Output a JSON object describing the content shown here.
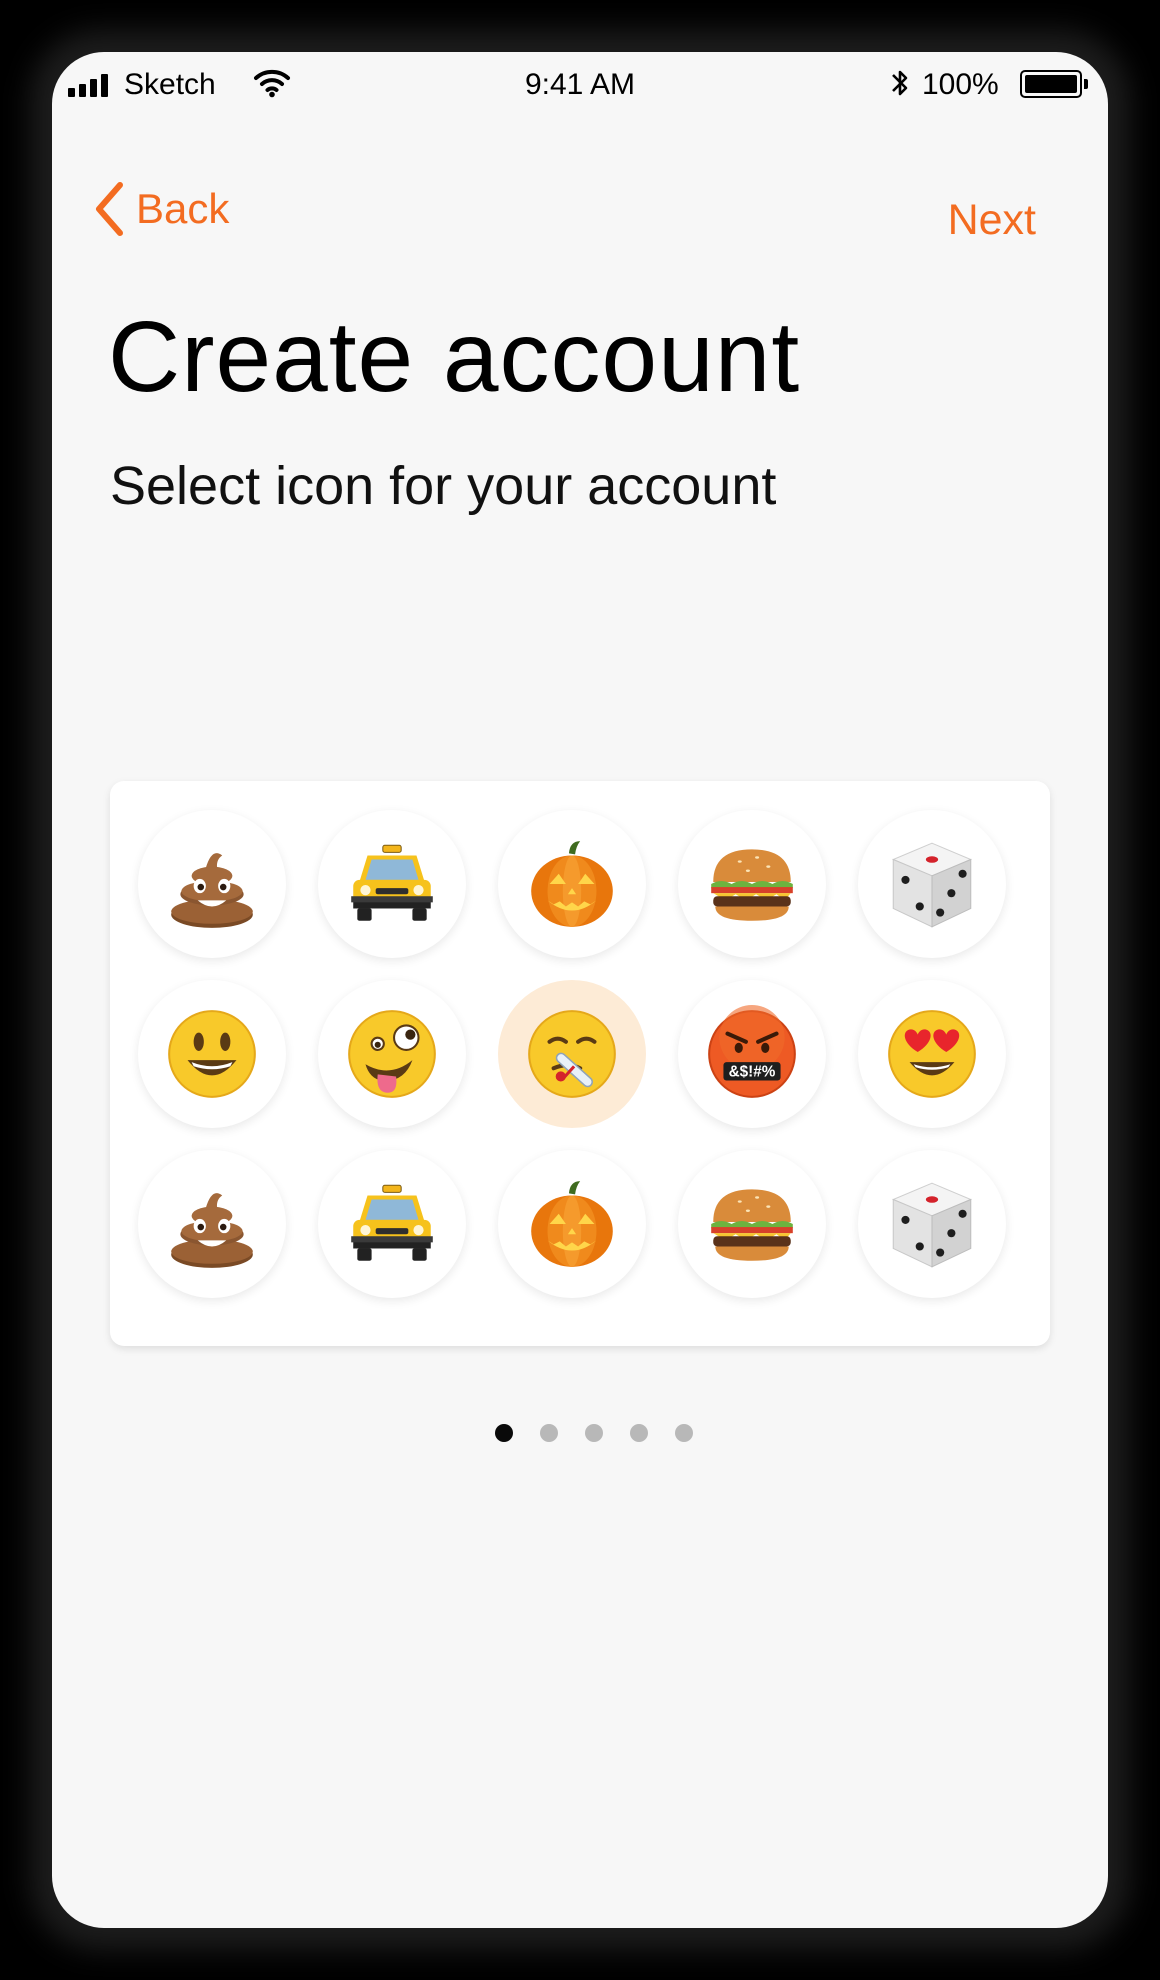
{
  "status_bar": {
    "carrier": "Sketch",
    "time": "9:41 AM",
    "battery": "100%",
    "signal_icon": "signal-bars-icon",
    "wifi_icon": "wifi-icon",
    "bluetooth_icon": "bluetooth-icon",
    "battery_icon": "battery-icon",
    "battery_level": 1.0
  },
  "nav": {
    "back_label": "Back",
    "back_icon": "chevron-left-icon",
    "next_label": "Next"
  },
  "title": "Create account",
  "subtitle": "Select icon for your account",
  "icon_picker": {
    "rows": [
      [
        "pile-of-poo",
        "taxi",
        "jack-o-lantern",
        "hamburger",
        "game-die"
      ],
      [
        "smiling-face",
        "zany-face",
        "face-with-thermometer",
        "face-with-symbols-on-mouth",
        "smiling-face-with-heart-eyes"
      ],
      [
        "pile-of-poo",
        "taxi",
        "jack-o-lantern",
        "hamburger",
        "game-die"
      ]
    ],
    "selected": "face-with-thermometer",
    "face_symbols_text": "&$!#%"
  },
  "pagination": {
    "count": 5,
    "active_index": 0
  },
  "colors": {
    "accent": "#f36c21",
    "screen_background": "#f7f7f7",
    "card_background": "#ffffff",
    "selected_background": "#fdebd6",
    "dot_active": "#0a0a0a",
    "dot_inactive": "#b8b8b8"
  }
}
